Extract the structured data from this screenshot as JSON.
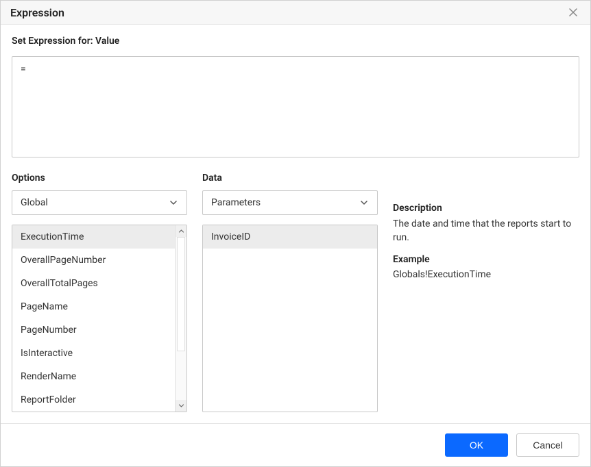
{
  "dialog": {
    "title": "Expression",
    "set_expression_label": "Set Expression for: Value",
    "expression_value": "="
  },
  "options": {
    "label": "Options",
    "selected": "Global",
    "items": [
      "ExecutionTime",
      "OverallPageNumber",
      "OverallTotalPages",
      "PageName",
      "PageNumber",
      "IsInteractive",
      "RenderName",
      "ReportFolder"
    ],
    "selected_index": 0
  },
  "data": {
    "label": "Data",
    "selected": "Parameters",
    "items": [
      "InvoiceID"
    ],
    "selected_index": 0
  },
  "description": {
    "title": "Description",
    "text": "The date and time that the reports start to run.",
    "example_title": "Example",
    "example_text": "Globals!ExecutionTime"
  },
  "footer": {
    "ok": "OK",
    "cancel": "Cancel"
  }
}
